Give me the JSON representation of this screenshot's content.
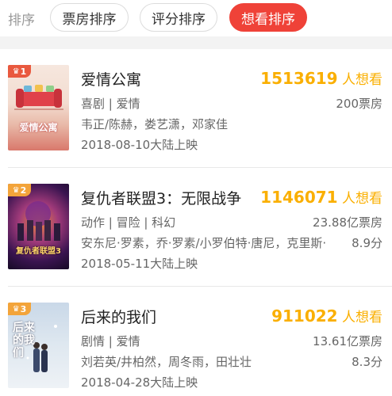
{
  "sortbar": {
    "label": "排序",
    "options": [
      "票房排序",
      "评分排序",
      "想看排序"
    ],
    "active_index": 2
  },
  "movies": [
    {
      "rank": "1",
      "title": "爱情公寓",
      "want_count": "1513619",
      "want_suffix": "人想看",
      "genre": "喜剧 | 爱情",
      "box_office": "200票房",
      "cast": "韦正/陈赫，娄艺潇，邓家佳",
      "score": "",
      "release": "2018-08-10大陆上映",
      "poster_text": "爱情公寓"
    },
    {
      "rank": "2",
      "title": "复仇者联盟3：无限战争",
      "want_count": "1146071",
      "want_suffix": "人想看",
      "genre": "动作 | 冒险 | 科幻",
      "box_office": "23.88亿票房",
      "cast": "安东尼·罗素，乔·罗素/小罗伯特·唐尼，克里斯·",
      "score": "8.9分",
      "release": "2018-05-11大陆上映",
      "poster_text": "复仇者联盟3"
    },
    {
      "rank": "3",
      "title": "后来的我们",
      "want_count": "911022",
      "want_suffix": "人想看",
      "genre": "剧情 | 爱情",
      "box_office": "13.61亿票房",
      "cast": "刘若英/井柏然，周冬雨，田壮壮",
      "score": "8.3分",
      "release": "2018-04-28大陆上映",
      "poster_text": "后来的我们"
    }
  ],
  "colors": {
    "accent_red": "#ef4238",
    "want_orange": "#faaf00",
    "rank1": "#e9593f",
    "rank_other": "#f3a43a"
  }
}
